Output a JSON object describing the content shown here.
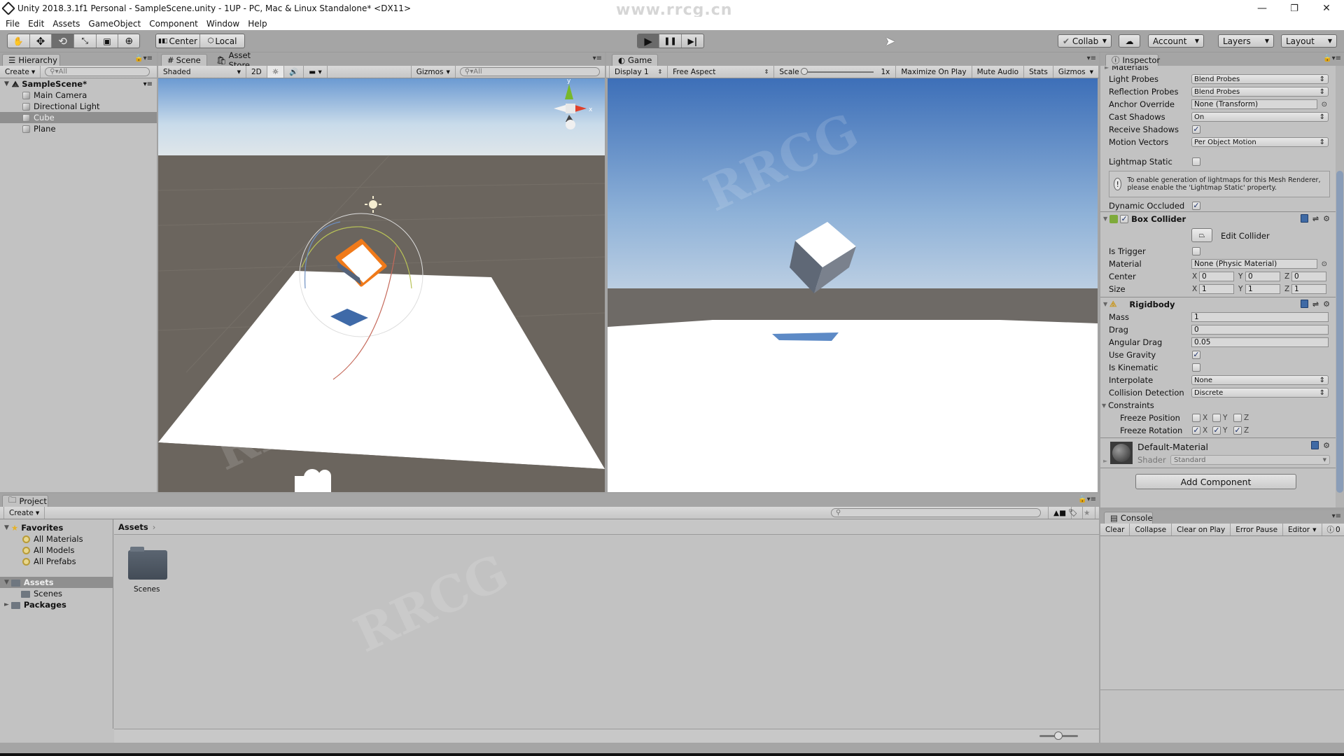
{
  "window": {
    "title": "Unity 2018.3.1f1 Personal - SampleScene.unity - 1UP - PC, Mac & Linux Standalone* <DX11>",
    "controls": [
      "minimize-icon",
      "restore-icon",
      "close-icon"
    ],
    "watermark_top": "www.rrcg.cn"
  },
  "menu": [
    "File",
    "Edit",
    "Assets",
    "GameObject",
    "Component",
    "Window",
    "Help"
  ],
  "toolbar": {
    "tools": [
      {
        "name": "hand-tool",
        "glyph": "✋"
      },
      {
        "name": "move-tool",
        "glyph": "✥"
      },
      {
        "name": "rotate-tool",
        "glyph": "⟲",
        "active": true
      },
      {
        "name": "scale-tool",
        "glyph": "⤡"
      },
      {
        "name": "rect-tool",
        "glyph": "▣"
      },
      {
        "name": "transform-tool",
        "glyph": "⊕"
      }
    ],
    "pivot": "Center",
    "space": "Local",
    "play": "▶",
    "pause": "❚❚",
    "step": "▶|",
    "collab": "Collab",
    "account": "Account",
    "layers": "Layers",
    "layout": "Layout"
  },
  "hierarchy": {
    "tab": "Hierarchy",
    "create": "Create",
    "search_placeholder": "All",
    "scene": "SampleScene*",
    "items": [
      {
        "label": "Main Camera",
        "selected": false
      },
      {
        "label": "Directional Light",
        "selected": false
      },
      {
        "label": "Cube",
        "selected": true
      },
      {
        "label": "Plane",
        "selected": false
      }
    ]
  },
  "scene": {
    "tabs": [
      "Scene",
      "Asset Store"
    ],
    "shading": "Shaded",
    "mode_2d": "2D",
    "gizmos": "Gizmos",
    "search_placeholder": "All",
    "axis_labels": {
      "x": "x",
      "y": "y"
    }
  },
  "game": {
    "tab": "Game",
    "display": "Display 1",
    "aspect": "Free Aspect",
    "scale_label": "Scale",
    "scale_value": "1x",
    "buttons": [
      "Maximize On Play",
      "Mute Audio",
      "Stats",
      "Gizmos"
    ]
  },
  "inspector": {
    "tab": "Inspector",
    "section_materials": "Materials",
    "mesh_renderer": [
      {
        "label": "Light Probes",
        "type": "dropdown",
        "value": "Blend Probes"
      },
      {
        "label": "Reflection Probes",
        "type": "dropdown",
        "value": "Blend Probes"
      },
      {
        "label": "Anchor Override",
        "type": "object",
        "value": "None (Transform)"
      },
      {
        "label": "Cast Shadows",
        "type": "dropdown",
        "value": "On"
      },
      {
        "label": "Receive Shadows",
        "type": "checkbox",
        "checked": true
      },
      {
        "label": "Motion Vectors",
        "type": "dropdown",
        "value": "Per Object Motion"
      }
    ],
    "lightmap_static": {
      "label": "Lightmap Static",
      "checked": false
    },
    "lightmap_help": "To enable generation of lightmaps for this Mesh Renderer, please enable the 'Lightmap Static' property.",
    "dynamic_occluded": {
      "label": "Dynamic Occluded",
      "checked": true
    },
    "box_collider": {
      "title": "Box Collider",
      "enabled": true,
      "edit_collider": "Edit Collider",
      "is_trigger": {
        "label": "Is Trigger",
        "checked": false
      },
      "material": {
        "label": "Material",
        "value": "None (Physic Material)"
      },
      "center": {
        "label": "Center",
        "x": "0",
        "y": "0",
        "z": "0"
      },
      "size": {
        "label": "Size",
        "x": "1",
        "y": "1",
        "z": "1"
      }
    },
    "rigidbody": {
      "title": "Rigidbody",
      "mass": {
        "label": "Mass",
        "value": "1"
      },
      "drag": {
        "label": "Drag",
        "value": "0"
      },
      "angular_drag": {
        "label": "Angular Drag",
        "value": "0.05"
      },
      "use_gravity": {
        "label": "Use Gravity",
        "checked": true
      },
      "is_kinematic": {
        "label": "Is Kinematic",
        "checked": false
      },
      "interpolate": {
        "label": "Interpolate",
        "value": "None"
      },
      "collision": {
        "label": "Collision Detection",
        "value": "Discrete"
      },
      "constraints": "Constraints",
      "freeze_position": {
        "label": "Freeze Position",
        "x": false,
        "y": false,
        "z": false
      },
      "freeze_rotation": {
        "label": "Freeze Rotation",
        "x": true,
        "y": true,
        "z": true
      },
      "axis": [
        "X",
        "Y",
        "Z"
      ]
    },
    "material": {
      "name": "Default-Material",
      "shader_label": "Shader",
      "shader": "Standard"
    },
    "add_component": "Add Component"
  },
  "console": {
    "tab": "Console",
    "buttons": [
      "Clear",
      "Collapse",
      "Clear on Play",
      "Error Pause",
      "Editor"
    ],
    "error_count": "0"
  },
  "project": {
    "tab": "Project",
    "create": "Create",
    "favorites": "Favorites",
    "favorite_items": [
      "All Materials",
      "All Models",
      "All Prefabs"
    ],
    "assets": "Assets",
    "asset_children": [
      "Scenes"
    ],
    "packages": "Packages",
    "breadcrumb": "Assets",
    "grid_items": [
      {
        "label": "Scenes",
        "type": "folder"
      }
    ]
  },
  "colors": {
    "panel_bg": "#c2c2c2",
    "toolbar_bg": "#a5a5a5",
    "selection": "#8f8f8f",
    "sky_top": "#3d6fb8",
    "ground": "#6b655e",
    "gizmo_x": "#e0402a",
    "gizmo_y": "#78b82a",
    "selection_outline": "#f07a1a"
  }
}
